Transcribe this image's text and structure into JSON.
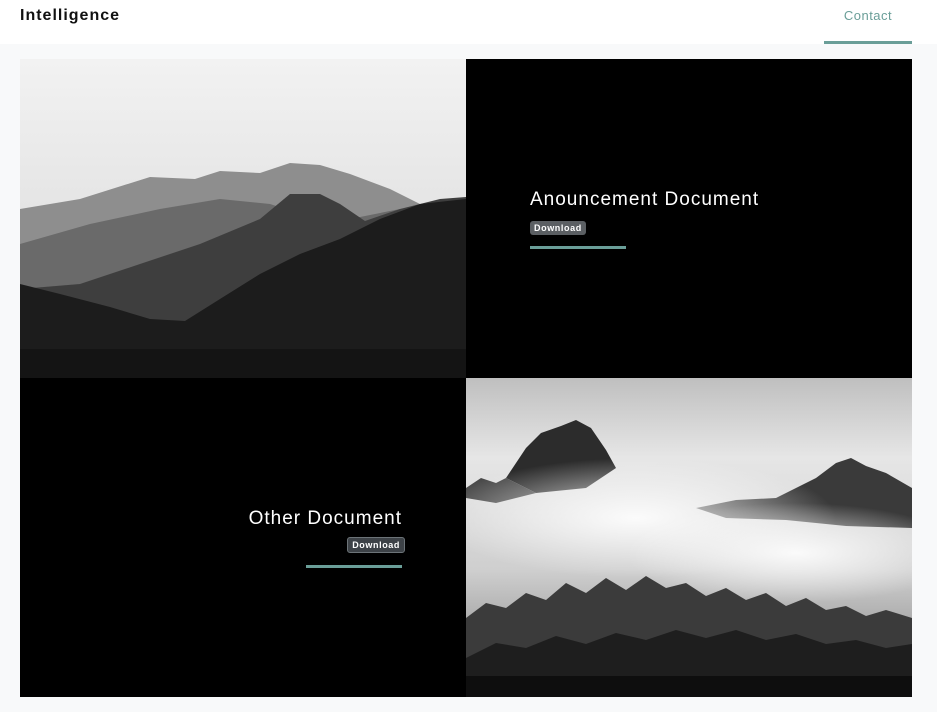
{
  "navbar": {
    "brand": "Intelligence",
    "contact_label": "Contact"
  },
  "documents": [
    {
      "title": "Anouncement Document",
      "button_label": "Download"
    },
    {
      "title": "Other Document",
      "button_label": "Download"
    }
  ],
  "colors": {
    "accent": "#6a9e98",
    "panel": "#000000",
    "page_bg": "#f8f9fa"
  }
}
